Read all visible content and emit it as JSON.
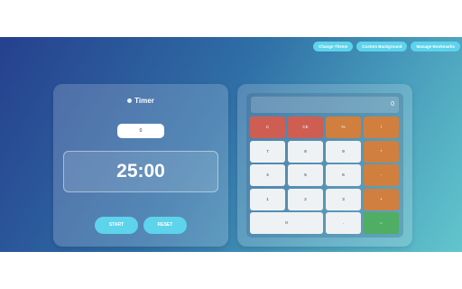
{
  "toolbar": {
    "change_theme": "Change Theme",
    "custom_background": "Custom Background",
    "manage_bookmarks": "Manage Bookmarks"
  },
  "timer": {
    "title": "Timer",
    "minutes_value": "0",
    "display": "25:00",
    "start_label": "START",
    "reset_label": "RESET"
  },
  "calculator": {
    "display": "0",
    "keys": [
      {
        "label": "C",
        "type": "clear"
      },
      {
        "label": "CE",
        "type": "clear"
      },
      {
        "label": "%",
        "type": "op"
      },
      {
        "label": "/",
        "type": "op"
      },
      {
        "label": "7",
        "type": "num"
      },
      {
        "label": "8",
        "type": "num"
      },
      {
        "label": "9",
        "type": "num"
      },
      {
        "label": "*",
        "type": "op"
      },
      {
        "label": "4",
        "type": "num"
      },
      {
        "label": "5",
        "type": "num"
      },
      {
        "label": "6",
        "type": "num"
      },
      {
        "label": "-",
        "type": "op"
      },
      {
        "label": "1",
        "type": "num"
      },
      {
        "label": "2",
        "type": "num"
      },
      {
        "label": "3",
        "type": "num"
      },
      {
        "label": "+",
        "type": "op"
      },
      {
        "label": "0",
        "type": "num"
      },
      {
        "label": ".",
        "type": "num"
      },
      {
        "label": "=",
        "type": "eq"
      }
    ]
  },
  "colors": {
    "accent": "#5ed3ec",
    "clear_key": "#cf5e52",
    "operator_key": "#d07f3e",
    "equals_key": "#4fae63"
  }
}
